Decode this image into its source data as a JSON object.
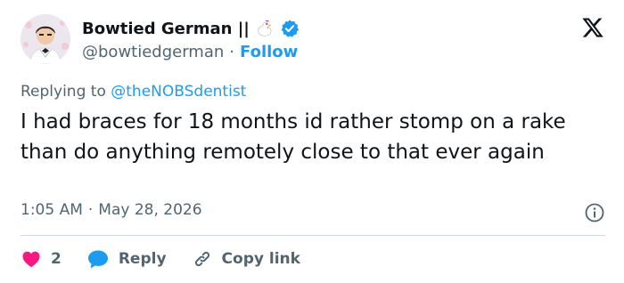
{
  "author": {
    "display_name": "Bowtied German ||",
    "handle": "@bowtiedgerman",
    "separator": "·",
    "follow_label": "Follow",
    "verified_color": "#1d9bf0"
  },
  "reply_context": {
    "prefix": "Replying to ",
    "mention": "@theNOBSdentist"
  },
  "tweet": {
    "text": "I had braces for 18 months id rather stomp on a rake than do anything remotely close to that ever again"
  },
  "meta": {
    "time": "1:05 AM",
    "separator": "·",
    "date": "May 28, 2026"
  },
  "actions": {
    "like_count": "2",
    "reply_label": "Reply",
    "copy_label": "Copy link"
  },
  "icons": {
    "brand": "x-logo-icon",
    "badge": "verified-badge-icon",
    "emoji": "chicken-icon",
    "info": "info-icon",
    "like": "heart-icon",
    "reply": "reply-bubble-icon",
    "copy": "link-icon"
  },
  "colors": {
    "accent": "#1d9bf0",
    "like": "#f91880",
    "text": "#0f1419",
    "secondary": "#536471",
    "divider": "#cfd9de"
  }
}
